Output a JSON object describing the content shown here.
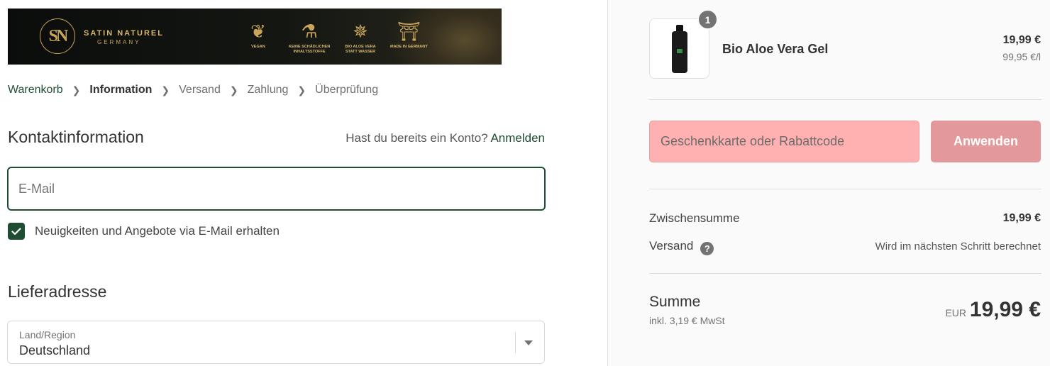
{
  "banner": {
    "brand_name": "SATIN NATUREL",
    "brand_sub": "GERMANY",
    "badges": [
      {
        "icon": "leaf-icon",
        "label": "VEGAN"
      },
      {
        "icon": "lab-icon",
        "label": "KEINE SCHÄDLICHEN INHALTSSTOFFE"
      },
      {
        "icon": "aloe-icon",
        "label": "BIO ALOE VERA STATT WASSER"
      },
      {
        "icon": "brandenburg-gate-icon",
        "label": "MADE IN GERMANY"
      }
    ]
  },
  "breadcrumb": {
    "items": [
      "Warenkorb",
      "Information",
      "Versand",
      "Zahlung",
      "Überprüfung"
    ],
    "active": "Information"
  },
  "contact": {
    "heading": "Kontaktinformation",
    "account_prompt": "Hast du bereits ein Konto?",
    "login_link": "Anmelden",
    "email_placeholder": "E-Mail",
    "newsletter_label": "Neuigkeiten und Angebote via E-Mail erhalten",
    "newsletter_checked": true
  },
  "delivery": {
    "heading": "Lieferadresse",
    "country_label": "Land/Region",
    "country_value": "Deutschland"
  },
  "summary": {
    "product": {
      "name": "Bio Aloe Vera Gel",
      "quantity": "1",
      "price": "19,99 €",
      "unit_price": "99,95 €/l"
    },
    "discount": {
      "placeholder": "Geschenkkarte oder Rabattcode",
      "apply_label": "Anwenden"
    },
    "subtotal_label": "Zwischensumme",
    "subtotal_value": "19,99 €",
    "shipping_label": "Versand",
    "shipping_value": "Wird im nächsten Schritt berechnet",
    "total_label": "Summe",
    "tax_note": "inkl. 3,19 € MwSt",
    "currency": "EUR",
    "total_value": "19,99 €"
  },
  "colors": {
    "accent": "#1f4d33",
    "discount_field": "#ffb0b0",
    "apply_button": "#e3999b",
    "summary_bg": "#fafafa"
  }
}
